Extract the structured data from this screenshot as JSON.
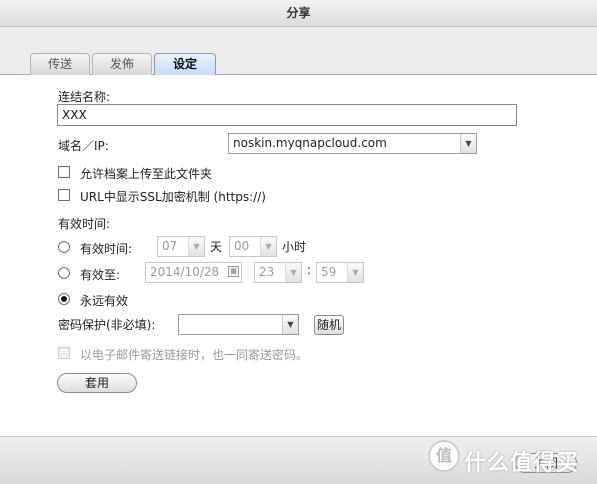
{
  "window": {
    "title": "分享"
  },
  "tabs": [
    {
      "label": "传送"
    },
    {
      "label": "发佈"
    },
    {
      "label": "设定"
    }
  ],
  "form": {
    "link_name_label": "连结名称:",
    "link_name_value": "XXX",
    "domain_label": "域名／IP:",
    "domain_value": "noskin.myqnapcloud.com",
    "allow_upload_label": "允许档案上传至此文件夹",
    "ssl_label": "URL中显示SSL加密机制 (https://)",
    "validity_label": "有效时间:",
    "valid_time_option": {
      "label": "有效时间:",
      "days_value": "07",
      "days_unit": "天",
      "hours_value": "00",
      "hours_unit": "小时"
    },
    "valid_until_option": {
      "label": "有效至:",
      "date_value": "2014/10/28",
      "hour_value": "23",
      "separator": ":",
      "minute_value": "59"
    },
    "forever_option": {
      "label": "永远有效"
    },
    "password_label": "密码保护(非必填):",
    "password_value": "",
    "random_button": "随机",
    "email_password_label": "以电子邮件寄送链接时，也一同寄送密码。",
    "apply_button": "套用"
  },
  "footer": {
    "close_button": "关闭"
  },
  "watermark": {
    "logo": "值",
    "text": "什么值得买"
  }
}
